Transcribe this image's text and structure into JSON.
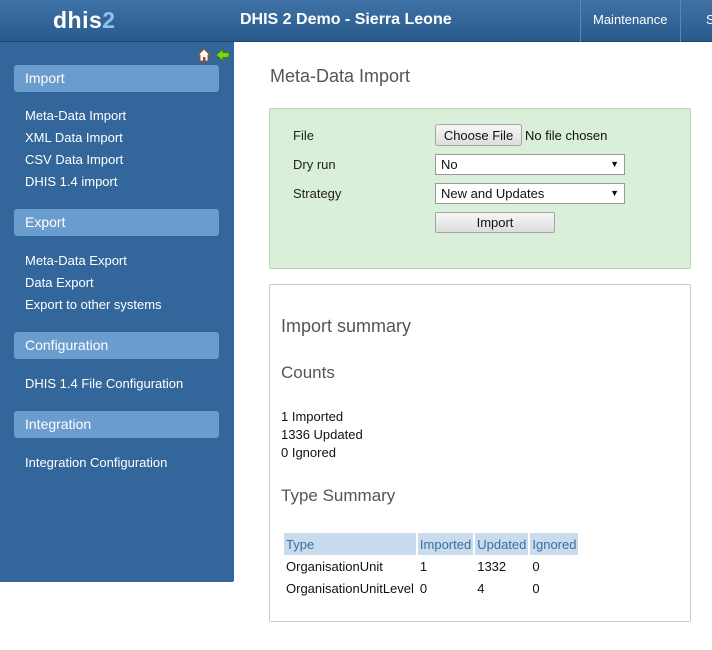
{
  "header": {
    "logo_main": "dhis",
    "logo_num": "2",
    "title": "DHIS 2 Demo - Sierra Leone",
    "menu": [
      {
        "label": "Maintenance"
      },
      {
        "label": "S"
      }
    ]
  },
  "sidebar": {
    "sections": [
      {
        "title": "Import",
        "links": [
          "Meta-Data Import",
          "XML Data Import",
          "CSV Data Import",
          "DHIS 1.4 import"
        ]
      },
      {
        "title": "Export",
        "links": [
          "Meta-Data Export",
          "Data Export",
          "Export to other systems"
        ]
      },
      {
        "title": "Configuration",
        "links": [
          "DHIS 1.4 File Configuration"
        ]
      },
      {
        "title": "Integration",
        "links": [
          "Integration Configuration"
        ]
      }
    ]
  },
  "main": {
    "page_title": "Meta-Data Import",
    "form": {
      "file_label": "File",
      "choose_file": "Choose File",
      "no_file": "No file chosen",
      "dry_run_label": "Dry run",
      "dry_run_value": "No",
      "strategy_label": "Strategy",
      "strategy_value": "New and Updates",
      "import_button": "Import"
    },
    "summary": {
      "title": "Import summary",
      "counts_title": "Counts",
      "counts": [
        "1 Imported",
        "1336 Updated",
        "0 Ignored"
      ],
      "type_summary_title": "Type Summary",
      "table": {
        "headers": [
          "Type",
          "Imported",
          "Updated",
          "Ignored"
        ],
        "rows": [
          [
            "OrganisationUnit",
            "1",
            "1332",
            "0"
          ],
          [
            "OrganisationUnitLevel",
            "0",
            "4",
            "0"
          ]
        ]
      }
    }
  },
  "colors": {
    "header_bg": "#2f6396",
    "sidebar_bg": "#33679b",
    "section_head_bg": "#6a9ccd",
    "form_bg": "#d9efd9",
    "table_header_bg": "#c8dced"
  }
}
